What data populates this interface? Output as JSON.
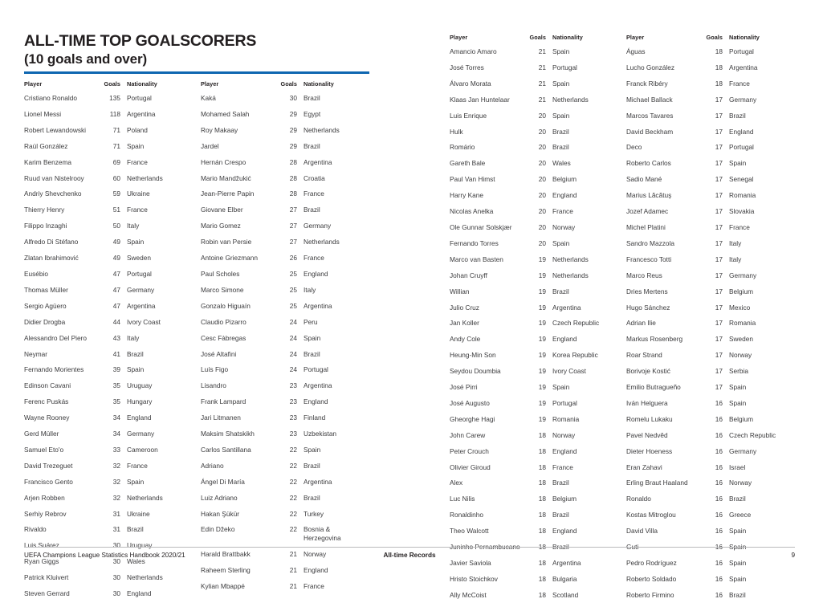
{
  "document": {
    "title": "ALL-TIME TOP GOALSCORERS",
    "subtitle": "(10 goals and over)",
    "accent_color": "#0f67b1",
    "text_color": "#3b3b3d",
    "heading_color": "#231f20"
  },
  "table": {
    "headers": {
      "player": "Player",
      "goals": "Goals",
      "nationality": "Nationality"
    }
  },
  "columns": [
    {
      "id": "column-1",
      "rows": [
        {
          "player": "Cristiano Ronaldo",
          "goals": "135",
          "nationality": "Portugal"
        },
        {
          "player": "Lionel Messi",
          "goals": "118",
          "nationality": "Argentina"
        },
        {
          "player": "Robert Lewandowski",
          "goals": "71",
          "nationality": "Poland"
        },
        {
          "player": "Raúl González",
          "goals": "71",
          "nationality": "Spain"
        },
        {
          "player": "Karim Benzema",
          "goals": "69",
          "nationality": "France"
        },
        {
          "player": "Ruud van Nistelrooy",
          "goals": "60",
          "nationality": "Netherlands"
        },
        {
          "player": "Andriy Shevchenko",
          "goals": "59",
          "nationality": "Ukraine"
        },
        {
          "player": "Thierry Henry",
          "goals": "51",
          "nationality": "France"
        },
        {
          "player": "Filippo Inzaghi",
          "goals": "50",
          "nationality": "Italy"
        },
        {
          "player": "Alfredo Di Stéfano",
          "goals": "49",
          "nationality": "Spain"
        },
        {
          "player": "Zlatan Ibrahimović",
          "goals": "49",
          "nationality": "Sweden"
        },
        {
          "player": "Eusébio",
          "goals": "47",
          "nationality": "Portugal"
        },
        {
          "player": "Thomas Müller",
          "goals": "47",
          "nationality": "Germany"
        },
        {
          "player": "Sergio Agüero",
          "goals": "47",
          "nationality": "Argentina"
        },
        {
          "player": "Didier Drogba",
          "goals": "44",
          "nationality": "Ivory Coast"
        },
        {
          "player": "Alessandro Del Piero",
          "goals": "43",
          "nationality": "Italy"
        },
        {
          "player": "Neymar",
          "goals": "41",
          "nationality": "Brazil"
        },
        {
          "player": "Fernando Morientes",
          "goals": "39",
          "nationality": "Spain"
        },
        {
          "player": "Edinson Cavani",
          "goals": "35",
          "nationality": "Uruguay"
        },
        {
          "player": "Ferenc Puskás",
          "goals": "35",
          "nationality": "Hungary"
        },
        {
          "player": "Wayne Rooney",
          "goals": "34",
          "nationality": "England"
        },
        {
          "player": "Gerd Müller",
          "goals": "34",
          "nationality": "Germany"
        },
        {
          "player": "Samuel Eto'o",
          "goals": "33",
          "nationality": "Cameroon"
        },
        {
          "player": "David Trezeguet",
          "goals": "32",
          "nationality": "France"
        },
        {
          "player": "Francisco Gento",
          "goals": "32",
          "nationality": "Spain"
        },
        {
          "player": "Arjen Robben",
          "goals": "32",
          "nationality": "Netherlands"
        },
        {
          "player": "Serhiy Rebrov",
          "goals": "31",
          "nationality": "Ukraine"
        },
        {
          "player": "Rivaldo",
          "goals": "31",
          "nationality": "Brazil"
        },
        {
          "player": "Luis Suárez",
          "goals": "30",
          "nationality": "Uruguay"
        },
        {
          "player": "Ryan Giggs",
          "goals": "30",
          "nationality": "Wales"
        },
        {
          "player": "Patrick Kluivert",
          "goals": "30",
          "nationality": "Netherlands"
        },
        {
          "player": "Steven Gerrard",
          "goals": "30",
          "nationality": "England"
        }
      ]
    },
    {
      "id": "column-2",
      "rows": [
        {
          "player": "Kaká",
          "goals": "30",
          "nationality": "Brazil"
        },
        {
          "player": "Mohamed Salah",
          "goals": "29",
          "nationality": "Egypt"
        },
        {
          "player": "Roy Makaay",
          "goals": "29",
          "nationality": "Netherlands"
        },
        {
          "player": "Jardel",
          "goals": "29",
          "nationality": "Brazil"
        },
        {
          "player": "Hernán Crespo",
          "goals": "28",
          "nationality": "Argentina"
        },
        {
          "player": "Mario Mandžukić",
          "goals": "28",
          "nationality": "Croatia"
        },
        {
          "player": "Jean-Pierre Papin",
          "goals": "28",
          "nationality": "France"
        },
        {
          "player": "Giovane Elber",
          "goals": "27",
          "nationality": "Brazil"
        },
        {
          "player": "Mario Gomez",
          "goals": "27",
          "nationality": "Germany"
        },
        {
          "player": "Robin van Persie",
          "goals": "27",
          "nationality": "Netherlands"
        },
        {
          "player": "Antoine Griezmann",
          "goals": "26",
          "nationality": "France"
        },
        {
          "player": "Paul Scholes",
          "goals": "25",
          "nationality": "England"
        },
        {
          "player": "Marco Simone",
          "goals": "25",
          "nationality": "Italy"
        },
        {
          "player": "Gonzalo Higuaín",
          "goals": "25",
          "nationality": "Argentina"
        },
        {
          "player": "Claudio Pizarro",
          "goals": "24",
          "nationality": "Peru"
        },
        {
          "player": "Cesc Fàbregas",
          "goals": "24",
          "nationality": "Spain"
        },
        {
          "player": "José Altafini",
          "goals": "24",
          "nationality": "Brazil"
        },
        {
          "player": "Luís Figo",
          "goals": "24",
          "nationality": "Portugal"
        },
        {
          "player": "Lisandro",
          "goals": "23",
          "nationality": "Argentina"
        },
        {
          "player": "Frank Lampard",
          "goals": "23",
          "nationality": "England"
        },
        {
          "player": "Jari Litmanen",
          "goals": "23",
          "nationality": "Finland"
        },
        {
          "player": "Maksim Shatskikh",
          "goals": "23",
          "nationality": "Uzbekistan"
        },
        {
          "player": "Carlos Santillana",
          "goals": "22",
          "nationality": "Spain"
        },
        {
          "player": "Adriano",
          "goals": "22",
          "nationality": "Brazil"
        },
        {
          "player": "Ángel Di María",
          "goals": "22",
          "nationality": "Argentina"
        },
        {
          "player": "Luiz Adriano",
          "goals": "22",
          "nationality": "Brazil"
        },
        {
          "player": "Hakan Şükür",
          "goals": "22",
          "nationality": "Turkey"
        },
        {
          "player": "Edin Džeko",
          "goals": "22",
          "nationality": "Bosnia & Herzegovina"
        },
        {
          "player": "Harald Brattbakk",
          "goals": "21",
          "nationality": "Norway"
        },
        {
          "player": "Raheem Sterling",
          "goals": "21",
          "nationality": "England"
        },
        {
          "player": "Kylian Mbappé",
          "goals": "21",
          "nationality": "France"
        }
      ]
    },
    {
      "id": "column-3",
      "rows": [
        {
          "player": "Amancio Amaro",
          "goals": "21",
          "nationality": "Spain"
        },
        {
          "player": "José Torres",
          "goals": "21",
          "nationality": "Portugal"
        },
        {
          "player": "Álvaro Morata",
          "goals": "21",
          "nationality": "Spain"
        },
        {
          "player": "Klaas Jan Huntelaar",
          "goals": "21",
          "nationality": "Netherlands"
        },
        {
          "player": "Luis Enrique",
          "goals": "20",
          "nationality": "Spain"
        },
        {
          "player": "Hulk",
          "goals": "20",
          "nationality": "Brazil"
        },
        {
          "player": "Romário",
          "goals": "20",
          "nationality": "Brazil"
        },
        {
          "player": "Gareth Bale",
          "goals": "20",
          "nationality": "Wales"
        },
        {
          "player": "Paul Van Himst",
          "goals": "20",
          "nationality": "Belgium"
        },
        {
          "player": "Harry Kane",
          "goals": "20",
          "nationality": "England"
        },
        {
          "player": "Nicolas Anelka",
          "goals": "20",
          "nationality": "France"
        },
        {
          "player": "Ole Gunnar Solskjær",
          "goals": "20",
          "nationality": "Norway"
        },
        {
          "player": "Fernando Torres",
          "goals": "20",
          "nationality": "Spain"
        },
        {
          "player": "Marco van Basten",
          "goals": "19",
          "nationality": "Netherlands"
        },
        {
          "player": "Johan Cruyff",
          "goals": "19",
          "nationality": "Netherlands"
        },
        {
          "player": "Willian",
          "goals": "19",
          "nationality": "Brazil"
        },
        {
          "player": "Julio Cruz",
          "goals": "19",
          "nationality": "Argentina"
        },
        {
          "player": "Jan Koller",
          "goals": "19",
          "nationality": "Czech Republic"
        },
        {
          "player": "Andy Cole",
          "goals": "19",
          "nationality": "England"
        },
        {
          "player": "Heung-Min Son",
          "goals": "19",
          "nationality": "Korea Republic"
        },
        {
          "player": "Seydou Doumbia",
          "goals": "19",
          "nationality": "Ivory Coast"
        },
        {
          "player": "José Pirri",
          "goals": "19",
          "nationality": "Spain"
        },
        {
          "player": "José Augusto",
          "goals": "19",
          "nationality": "Portugal"
        },
        {
          "player": "Gheorghe Hagi",
          "goals": "19",
          "nationality": "Romania"
        },
        {
          "player": "John Carew",
          "goals": "18",
          "nationality": "Norway"
        },
        {
          "player": "Peter Crouch",
          "goals": "18",
          "nationality": "England"
        },
        {
          "player": "Olivier Giroud",
          "goals": "18",
          "nationality": "France"
        },
        {
          "player": "Alex",
          "goals": "18",
          "nationality": "Brazil"
        },
        {
          "player": "Luc Nilis",
          "goals": "18",
          "nationality": "Belgium"
        },
        {
          "player": "Ronaldinho",
          "goals": "18",
          "nationality": "Brazil"
        },
        {
          "player": "Theo Walcott",
          "goals": "18",
          "nationality": "England"
        },
        {
          "player": "Juninho Pernambucano",
          "goals": "18",
          "nationality": "Brazil"
        },
        {
          "player": "Javier Saviola",
          "goals": "18",
          "nationality": "Argentina"
        },
        {
          "player": "Hristo Stoichkov",
          "goals": "18",
          "nationality": "Bulgaria"
        },
        {
          "player": "Ally McCoist",
          "goals": "18",
          "nationality": "Scotland"
        }
      ]
    },
    {
      "id": "column-4",
      "rows": [
        {
          "player": "Águas",
          "goals": "18",
          "nationality": "Portugal"
        },
        {
          "player": "Lucho González",
          "goals": "18",
          "nationality": "Argentina"
        },
        {
          "player": "Franck Ribéry",
          "goals": "18",
          "nationality": "France"
        },
        {
          "player": "Michael Ballack",
          "goals": "17",
          "nationality": "Germany"
        },
        {
          "player": "Marcos Tavares",
          "goals": "17",
          "nationality": "Brazil"
        },
        {
          "player": "David Beckham",
          "goals": "17",
          "nationality": "England"
        },
        {
          "player": "Deco",
          "goals": "17",
          "nationality": "Portugal"
        },
        {
          "player": "Roberto Carlos",
          "goals": "17",
          "nationality": "Spain"
        },
        {
          "player": "Sadio Mané",
          "goals": "17",
          "nationality": "Senegal"
        },
        {
          "player": "Marius Lăcătuş",
          "goals": "17",
          "nationality": "Romania"
        },
        {
          "player": "Jozef Adamec",
          "goals": "17",
          "nationality": "Slovakia"
        },
        {
          "player": "Michel Platini",
          "goals": "17",
          "nationality": "France"
        },
        {
          "player": "Sandro Mazzola",
          "goals": "17",
          "nationality": "Italy"
        },
        {
          "player": "Francesco Totti",
          "goals": "17",
          "nationality": "Italy"
        },
        {
          "player": "Marco Reus",
          "goals": "17",
          "nationality": "Germany"
        },
        {
          "player": "Dries Mertens",
          "goals": "17",
          "nationality": "Belgium"
        },
        {
          "player": "Hugo Sánchez",
          "goals": "17",
          "nationality": "Mexico"
        },
        {
          "player": "Adrian Ilie",
          "goals": "17",
          "nationality": "Romania"
        },
        {
          "player": "Markus Rosenberg",
          "goals": "17",
          "nationality": "Sweden"
        },
        {
          "player": "Roar Strand",
          "goals": "17",
          "nationality": "Norway"
        },
        {
          "player": "Borivoje Kostić",
          "goals": "17",
          "nationality": "Serbia"
        },
        {
          "player": "Emilio Butragueño",
          "goals": "17",
          "nationality": "Spain"
        },
        {
          "player": "Iván Helguera",
          "goals": "16",
          "nationality": "Spain"
        },
        {
          "player": "Romelu Lukaku",
          "goals": "16",
          "nationality": "Belgium"
        },
        {
          "player": "Pavel Nedvěd",
          "goals": "16",
          "nationality": "Czech Republic"
        },
        {
          "player": "Dieter Hoeness",
          "goals": "16",
          "nationality": "Germany"
        },
        {
          "player": "Eran Zahavi",
          "goals": "16",
          "nationality": "Israel"
        },
        {
          "player": "Erling Braut Haaland",
          "goals": "16",
          "nationality": "Norway"
        },
        {
          "player": "Ronaldo",
          "goals": "16",
          "nationality": "Brazil"
        },
        {
          "player": "Kostas Mitroglou",
          "goals": "16",
          "nationality": "Greece"
        },
        {
          "player": "David Villa",
          "goals": "16",
          "nationality": "Spain"
        },
        {
          "player": "Guti",
          "goals": "16",
          "nationality": "Spain"
        },
        {
          "player": "Pedro Rodríguez",
          "goals": "16",
          "nationality": "Spain"
        },
        {
          "player": "Roberto Soldado",
          "goals": "16",
          "nationality": "Spain"
        },
        {
          "player": "Roberto Firmino",
          "goals": "16",
          "nationality": "Brazil"
        }
      ]
    }
  ],
  "footer": {
    "left": "UEFA Champions League Statistics Handbook 2020/21",
    "center": "All-time Records",
    "right": "9"
  }
}
